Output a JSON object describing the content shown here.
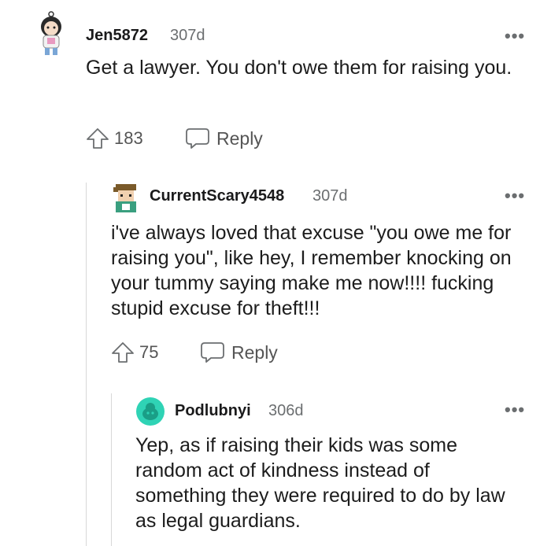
{
  "comments": [
    {
      "username": "Jen5872",
      "age": "307d",
      "more": "•••",
      "body": "Get a lawyer. You don't owe them for raising you.",
      "upvotes": "183",
      "reply_label": "Reply"
    },
    {
      "username": "CurrentScary4548",
      "age": "307d",
      "more": "•••",
      "body": "i've always loved that excuse \"you owe me for raising you\", like hey, I remember knocking on your tummy saying make me now!!!! fucking stupid excuse for theft!!!",
      "upvotes": "75",
      "reply_label": "Reply"
    },
    {
      "username": "Podlubnyi",
      "age": "306d",
      "more": "•••",
      "body": "Yep, as if raising their kids was some random act of kindness instead of something they were required to do by law as legal guardians."
    }
  ],
  "colors": {
    "accent_teal": "#2fd3b5",
    "meta_gray": "#6b6e70",
    "thread_line": "#d8d8d8"
  },
  "icons": [
    "anime-avatar",
    "upvote-arrow-icon",
    "reply-bubble-icon",
    "more-options-icon",
    "snoo-avatar"
  ]
}
